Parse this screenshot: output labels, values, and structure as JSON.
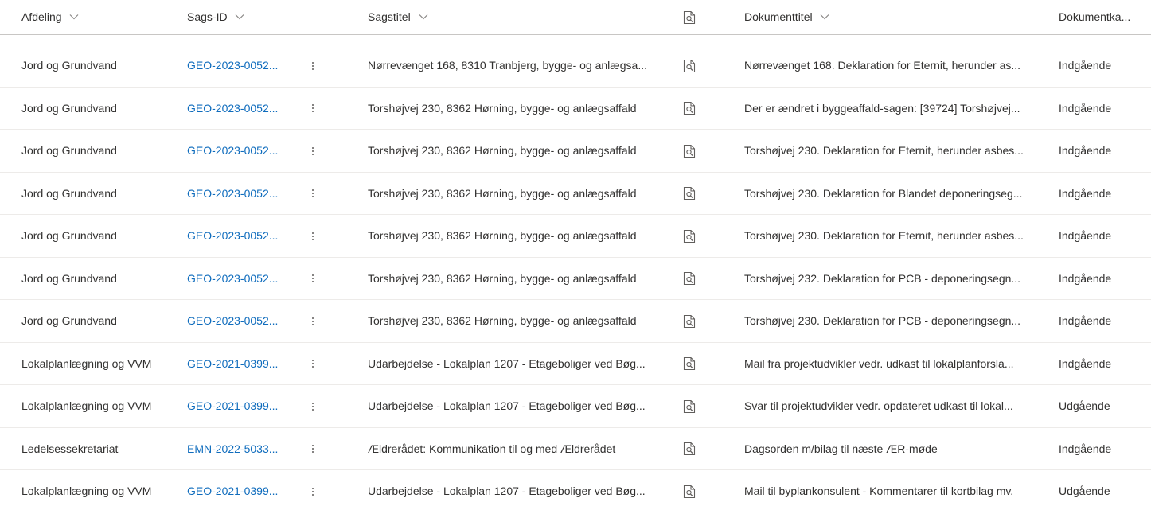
{
  "columns": {
    "afdeling": "Afdeling",
    "sags_id": "Sags-ID",
    "sagstitel": "Sagstitel",
    "preview_icon": "document-preview-icon",
    "dokumenttitel": "Dokumenttitel",
    "dokumentkategori": "Dokumentka..."
  },
  "rows": [
    {
      "afdeling": "Jord og Grundvand",
      "sags_id": "GEO-2023-0052...",
      "sagstitel": "Nørrevænget 168, 8310 Tranbjerg, bygge- og anlægsa...",
      "dokumenttitel": "Nørrevænget 168. Deklaration for Eternit, herunder as...",
      "dokumentkategori": "Indgående"
    },
    {
      "afdeling": "Jord og Grundvand",
      "sags_id": "GEO-2023-0052...",
      "sagstitel": "Torshøjvej 230, 8362 Hørning, bygge- og anlægsaffald",
      "dokumenttitel": "Der er ændret i byggeaffald-sagen: [39724] Torshøjvej...",
      "dokumentkategori": "Indgående"
    },
    {
      "afdeling": "Jord og Grundvand",
      "sags_id": "GEO-2023-0052...",
      "sagstitel": "Torshøjvej 230, 8362 Hørning, bygge- og anlægsaffald",
      "dokumenttitel": "Torshøjvej 230. Deklaration for Eternit, herunder asbes...",
      "dokumentkategori": "Indgående"
    },
    {
      "afdeling": "Jord og Grundvand",
      "sags_id": "GEO-2023-0052...",
      "sagstitel": "Torshøjvej 230, 8362 Hørning, bygge- og anlægsaffald",
      "dokumenttitel": "Torshøjvej 230. Deklaration for Blandet deponeringseg...",
      "dokumentkategori": "Indgående"
    },
    {
      "afdeling": "Jord og Grundvand",
      "sags_id": "GEO-2023-0052...",
      "sagstitel": "Torshøjvej 230, 8362 Hørning, bygge- og anlægsaffald",
      "dokumenttitel": "Torshøjvej 230. Deklaration for Eternit, herunder asbes...",
      "dokumentkategori": "Indgående"
    },
    {
      "afdeling": "Jord og Grundvand",
      "sags_id": "GEO-2023-0052...",
      "sagstitel": "Torshøjvej 230, 8362 Hørning, bygge- og anlægsaffald",
      "dokumenttitel": "Torshøjvej 232. Deklaration for PCB - deponeringsegn...",
      "dokumentkategori": "Indgående"
    },
    {
      "afdeling": "Jord og Grundvand",
      "sags_id": "GEO-2023-0052...",
      "sagstitel": "Torshøjvej 230, 8362 Hørning, bygge- og anlægsaffald",
      "dokumenttitel": "Torshøjvej 230. Deklaration for PCB - deponeringsegn...",
      "dokumentkategori": "Indgående"
    },
    {
      "afdeling": "Lokalplanlægning og VVM",
      "sags_id": "GEO-2021-0399...",
      "sagstitel": "Udarbejdelse - Lokalplan 1207 - Etageboliger ved Bøg...",
      "dokumenttitel": "Mail fra projektudvikler vedr. udkast til lokalplanforsla...",
      "dokumentkategori": "Indgående"
    },
    {
      "afdeling": "Lokalplanlægning og VVM",
      "sags_id": "GEO-2021-0399...",
      "sagstitel": "Udarbejdelse - Lokalplan 1207 - Etageboliger ved Bøg...",
      "dokumenttitel": "Svar til projektudvikler vedr. opdateret udkast til lokal...",
      "dokumentkategori": "Udgående"
    },
    {
      "afdeling": "Ledelsessekretariat",
      "sags_id": "EMN-2022-5033...",
      "sagstitel": "Ældrerådet: Kommunikation til og med Ældrerådet",
      "dokumenttitel": "Dagsorden m/bilag til næste ÆR-møde",
      "dokumentkategori": "Indgående"
    },
    {
      "afdeling": "Lokalplanlægning og VVM",
      "sags_id": "GEO-2021-0399...",
      "sagstitel": "Udarbejdelse - Lokalplan 1207 - Etageboliger ved Bøg...",
      "dokumenttitel": "Mail til byplankonsulent - Kommentarer til kortbilag mv.",
      "dokumentkategori": "Udgående"
    }
  ],
  "colors": {
    "link": "#0f6cbd",
    "text": "#323130",
    "divider": "#edebe9"
  }
}
